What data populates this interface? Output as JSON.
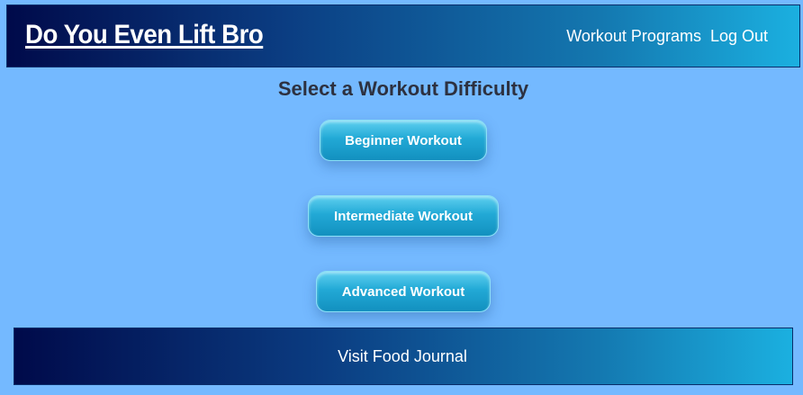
{
  "header": {
    "brand": "Do You Even Lift Bro",
    "nav": {
      "workout_programs": "Workout Programs",
      "log_out": "Log Out"
    }
  },
  "main": {
    "heading": "Select a Workout Difficulty",
    "buttons": {
      "beginner": "Beginner Workout",
      "intermediate": "Intermediate Workout",
      "advanced": "Advanced Workout"
    }
  },
  "footer": {
    "link": "Visit Food Journal"
  },
  "colors": {
    "page_background": "#74b9ff",
    "header_gradient_start": "#000a4a",
    "header_gradient_end": "#1bb0e0",
    "button_color": "#22a9d6",
    "heading_text": "#2d3140"
  }
}
